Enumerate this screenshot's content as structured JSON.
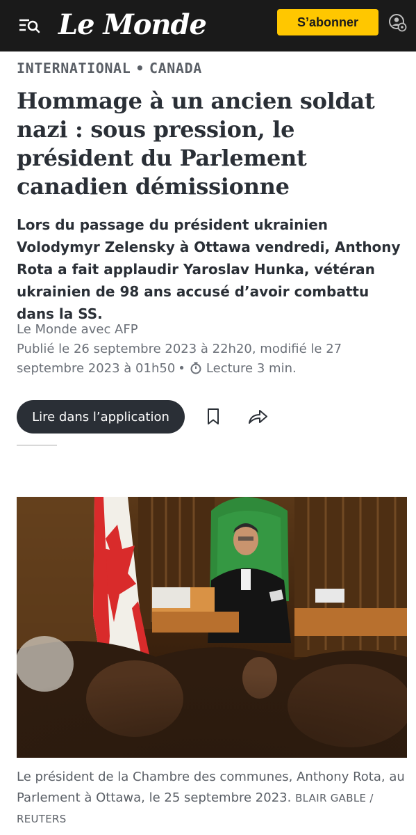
{
  "header": {
    "logo": "Le Monde",
    "subscribe_label": "S’abonner"
  },
  "breadcrumb": {
    "section": "INTERNATIONAL",
    "separator": "•",
    "subsection": "CANADA"
  },
  "article": {
    "title": "Hommage à un ancien soldat nazi : sous pression, le président du Parlement canadien démissionne",
    "description": "Lors du passage du président ukrainien Volodymyr Zelensky à Ottawa vendredi, Anthony Rota a fait applaudir Yaroslav Hunka, vétéran ukrainien de 98 ans accusé d’avoir combattu dans la SS.",
    "author": "Le Monde avec AFP",
    "published": "Publié le 26 septembre 2023 à 22h20, modifié le 27 septembre 2023 à 01h50",
    "dot": "•",
    "reading_time": "Lecture 3 min.",
    "read_in_app_label": "Lire dans l’application"
  },
  "image": {
    "caption": "Le président de la Chambre des communes, Anthony Rota, au Parlement à Ottawa, le 25 septembre 2023.",
    "credit": "BLAIR GABLE / REUTERS"
  },
  "colors": {
    "topbar": "#1a1a1a",
    "subscribe": "#ffc700",
    "text_dark": "#2a2f36",
    "text_muted": "#6b7078"
  },
  "icons": [
    "menu-search-icon",
    "account-settings-icon",
    "timer-icon",
    "bookmark-icon",
    "share-icon"
  ]
}
